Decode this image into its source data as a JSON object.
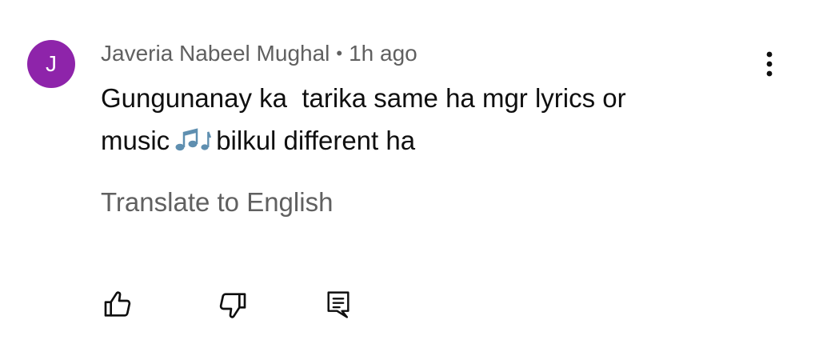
{
  "comment": {
    "avatar_letter": "J",
    "author": "Javeria Nabeel Mughal",
    "separator": "•",
    "time": "1h ago",
    "text_line1": "Gungunanay ka  tarika same ha mgr lyrics or",
    "text_line2_before": "music",
    "text_line2_after": "bilkul different ha",
    "emoji_icon": "musical-notes-icon",
    "translate_label": "Translate to English"
  },
  "icons": {
    "menu": "more-vertical-icon",
    "like": "thumbs-up-icon",
    "dislike": "thumbs-down-icon",
    "reply": "reply-comment-icon"
  },
  "colors": {
    "avatar_bg": "#8e24aa",
    "secondary_text": "#606060",
    "primary_text": "#0f0f0f",
    "emoji_blue": "#5f8fb0"
  }
}
